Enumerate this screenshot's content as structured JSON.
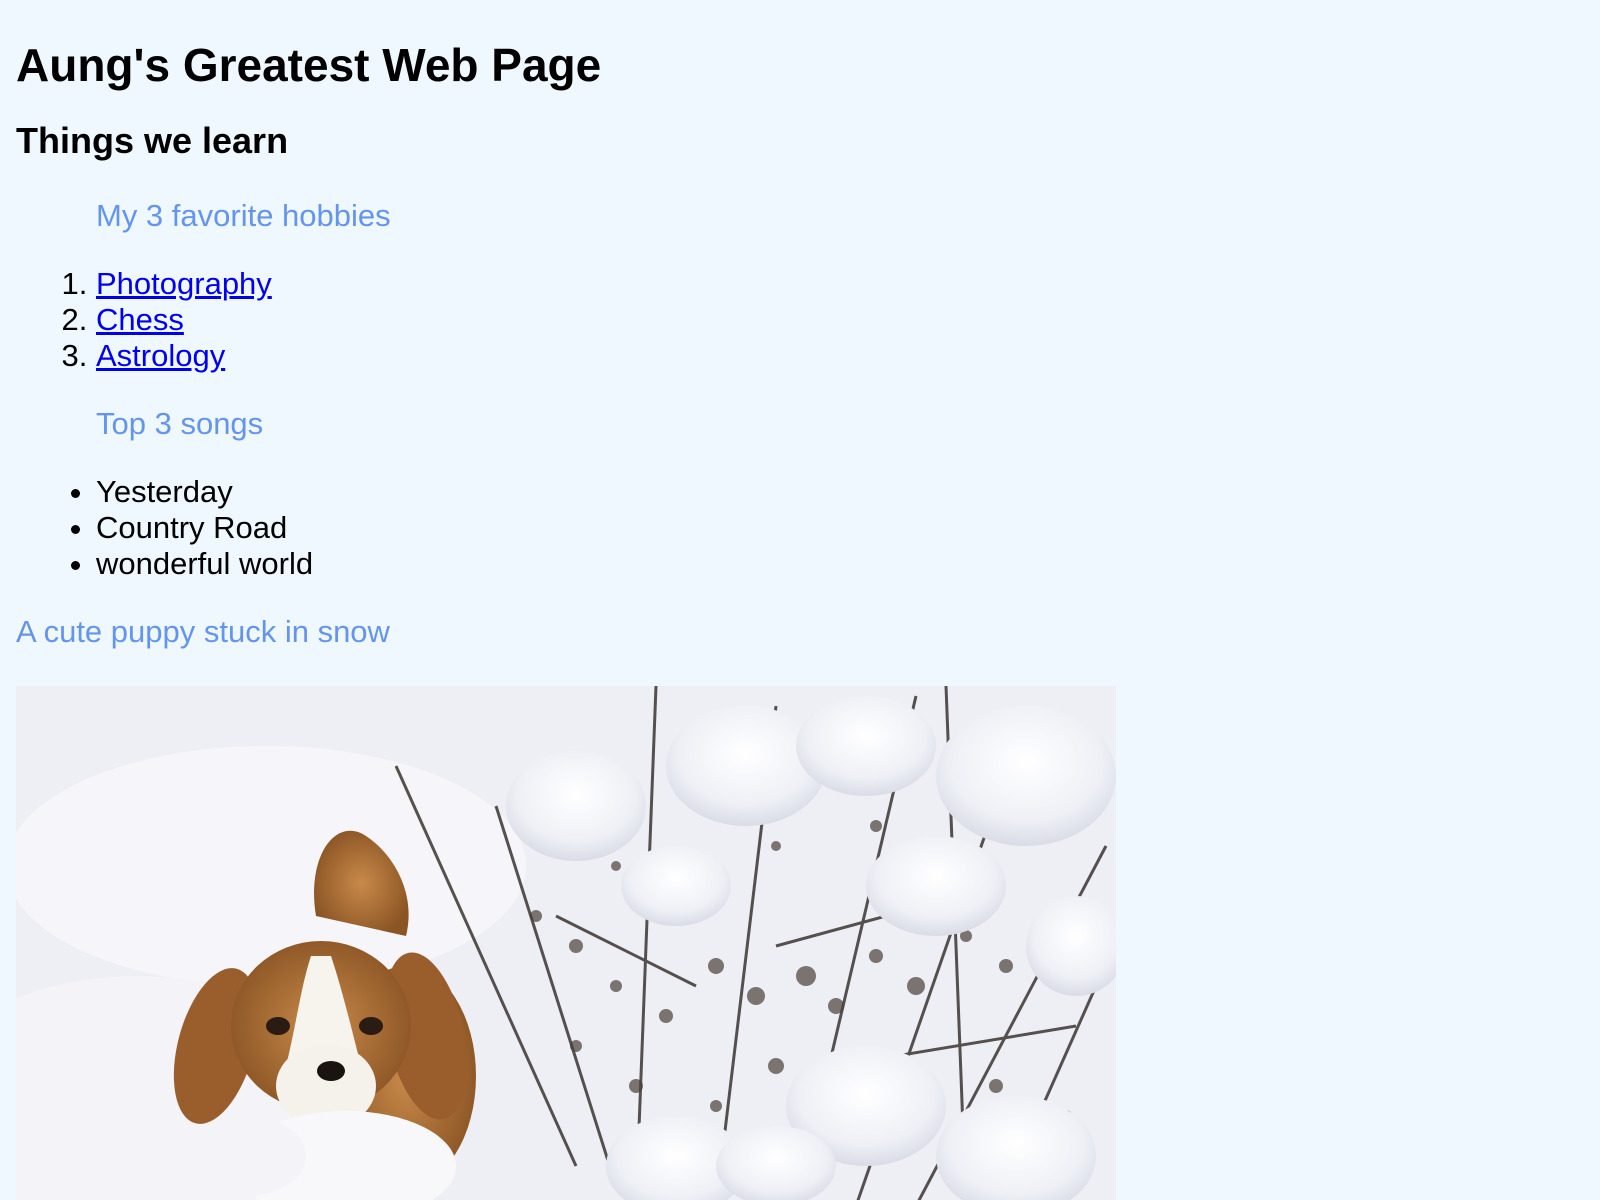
{
  "page": {
    "title": "Aung's Greatest Web Page",
    "subtitle": "Things we learn"
  },
  "hobbies": {
    "caption": "My 3 favorite hobbies",
    "items": [
      "Photography",
      "Chess",
      "Astrology"
    ]
  },
  "songs": {
    "caption": "Top 3 songs",
    "items": [
      "Yesterday",
      "Country Road",
      "wonderful world"
    ]
  },
  "puppy": {
    "caption": "A cute puppy stuck in snow"
  },
  "colors": {
    "background": "#f0f8ff",
    "caption": "#6495ed",
    "link": "#0000ee"
  }
}
